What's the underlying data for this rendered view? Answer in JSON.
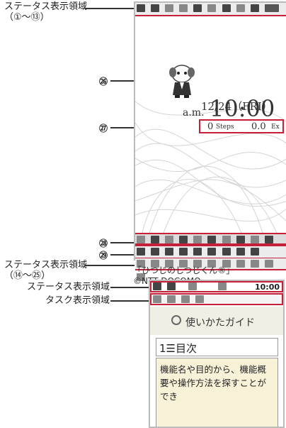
{
  "labels": {
    "status_area_top": "ステータス表示領域",
    "status_area_top_range": "（①～⑬）",
    "status_area_bottom": "ステータス表示領域",
    "status_area_bottom_range": "（⑭～㉕）",
    "callout_26": "㉖",
    "callout_27": "㉗",
    "callout_28": "㉘",
    "callout_29": "㉙",
    "status_area_2": "ステータス表示領域",
    "task_area": "タスク表示領域"
  },
  "standby": {
    "date": "12/24（FRI）",
    "ampm": "a.m.",
    "time": "10:00",
    "steps_value": "0",
    "steps_unit": "Steps",
    "ex_value": "0.0",
    "ex_unit": "Ex"
  },
  "credit": {
    "line1": "「ひつじのしつじくん®」",
    "line2": "©NTT DOCOMO"
  },
  "guide_screen": {
    "time": "10:00",
    "title": "使いかたガイド",
    "toc_label": "1☰目次",
    "description": "機能名や目的から、機能概要や操作方法を探すことができ"
  },
  "colors": {
    "accent_border": "#c61f3a"
  }
}
